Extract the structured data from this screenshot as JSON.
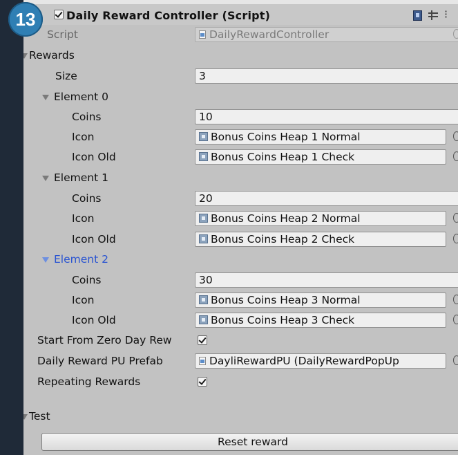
{
  "badge": "13",
  "component": {
    "title": "Daily Reward Controller (Script)",
    "enabled": true
  },
  "script_row": {
    "label": "Script",
    "value": "DailyRewardController"
  },
  "rewards": {
    "label": "Rewards",
    "size_label": "Size",
    "size_value": "3",
    "elements": [
      {
        "label": "Element 0",
        "coins_label": "Coins",
        "coins": "10",
        "icon_label": "Icon",
        "icon": "Bonus Coins Heap 1 Normal",
        "icon_old_label": "Icon Old",
        "icon_old": "Bonus Coins Heap 1 Check"
      },
      {
        "label": "Element 1",
        "coins_label": "Coins",
        "coins": "20",
        "icon_label": "Icon",
        "icon": "Bonus Coins Heap 2 Normal",
        "icon_old_label": "Icon Old",
        "icon_old": "Bonus Coins Heap 2 Check"
      },
      {
        "label": "Element 2",
        "coins_label": "Coins",
        "coins": "30",
        "icon_label": "Icon",
        "icon": "Bonus Coins Heap 3 Normal",
        "icon_old_label": "Icon Old",
        "icon_old": "Bonus Coins Heap 3 Check"
      }
    ]
  },
  "start_from_zero": {
    "label": "Start From Zero Day Rew",
    "checked": true
  },
  "prefab": {
    "label": "Daily Reward PU Prefab",
    "value": "DayliRewardPU (DailyRewardPopUp"
  },
  "repeating": {
    "label": "Repeating Rewards",
    "checked": true
  },
  "test": {
    "label": "Test",
    "button": "Reset reward"
  },
  "colors": {
    "inspector_bg": "#c2c2c2",
    "badge": "#2f7fb4",
    "selected_text": "#2a54d1",
    "frame": "#1f2a38"
  },
  "icons": [
    "checkbox-icon",
    "help-book-icon",
    "settings-icon",
    "more-icon",
    "foldout-arrow-icon",
    "texture-icon",
    "script-file-icon",
    "object-picker-icon"
  ]
}
